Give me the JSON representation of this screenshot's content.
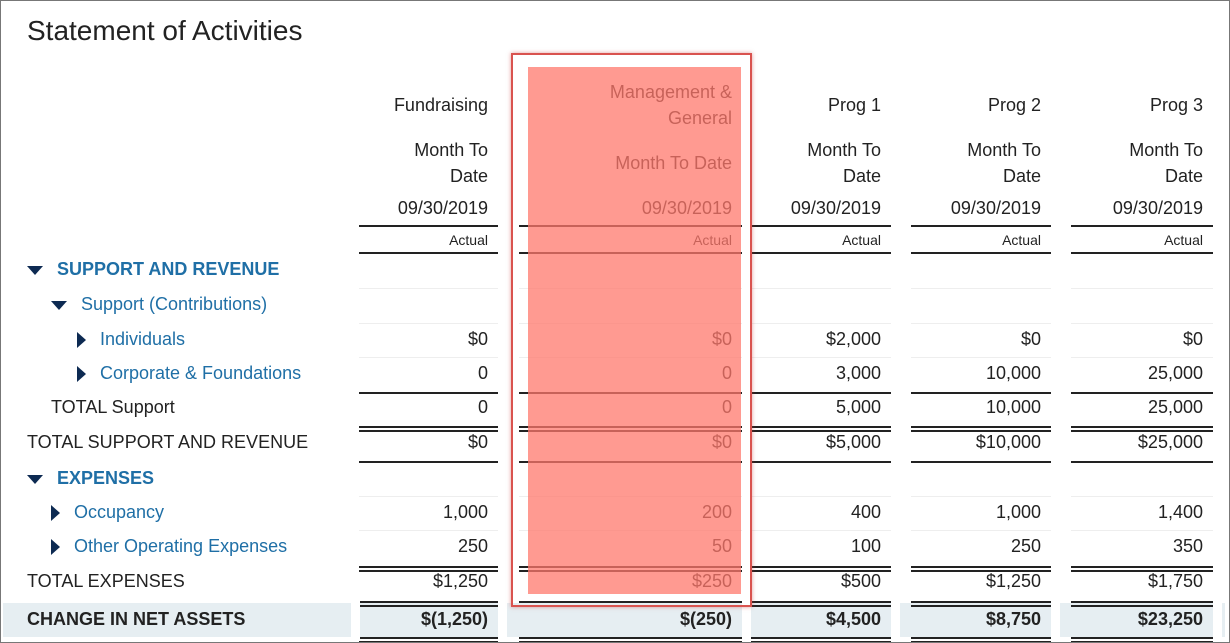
{
  "title": "Statement of Activities",
  "highlight_color": "#ff786c",
  "columns": [
    {
      "name": "Fundraising",
      "period": "Month To Date",
      "date": "09/30/2019",
      "type": "Actual"
    },
    {
      "name": "Management & General",
      "period": "Month To Date",
      "date": "09/30/2019",
      "type": "Actual"
    },
    {
      "name": "Prog 1",
      "period": "Month To Date",
      "date": "09/30/2019",
      "type": "Actual"
    },
    {
      "name": "Prog 2",
      "period": "Month To Date",
      "date": "09/30/2019",
      "type": "Actual"
    },
    {
      "name": "Prog 3",
      "period": "Month To Date",
      "date": "09/30/2019",
      "type": "Actual"
    }
  ],
  "rows": [
    {
      "label": "SUPPORT AND REVENUE",
      "kind": "section",
      "toggle": "expanded",
      "values": []
    },
    {
      "label": "Support (Contributions)",
      "kind": "group",
      "toggle": "expanded",
      "values": []
    },
    {
      "label": "Individuals",
      "kind": "account",
      "toggle": "collapsed",
      "values": [
        "$0",
        "$0",
        "$2,000",
        "$0",
        "$0"
      ]
    },
    {
      "label": "Corporate & Foundations",
      "kind": "account",
      "toggle": "collapsed",
      "values": [
        "0",
        "0",
        "3,000",
        "10,000",
        "25,000"
      ]
    },
    {
      "label": "TOTAL Support",
      "kind": "subtotal",
      "values": [
        "0",
        "0",
        "5,000",
        "10,000",
        "25,000"
      ]
    },
    {
      "label": "TOTAL SUPPORT AND REVENUE",
      "kind": "total",
      "values": [
        "$0",
        "$0",
        "$5,000",
        "$10,000",
        "$25,000"
      ]
    },
    {
      "label": "EXPENSES",
      "kind": "section",
      "toggle": "expanded",
      "values": []
    },
    {
      "label": "Occupancy",
      "kind": "group",
      "toggle": "collapsed",
      "values": [
        "1,000",
        "200",
        "400",
        "1,000",
        "1,400"
      ]
    },
    {
      "label": "Other Operating Expenses",
      "kind": "group",
      "toggle": "collapsed",
      "values": [
        "250",
        "50",
        "100",
        "250",
        "350"
      ]
    },
    {
      "label": "TOTAL EXPENSES",
      "kind": "total",
      "values": [
        "$1,250",
        "$250",
        "$500",
        "$1,250",
        "$1,750"
      ]
    },
    {
      "label": "CHANGE IN NET ASSETS",
      "kind": "grand",
      "values": [
        "$(1,250)",
        "$(250)",
        "$4,500",
        "$8,750",
        "$23,250"
      ]
    }
  ]
}
